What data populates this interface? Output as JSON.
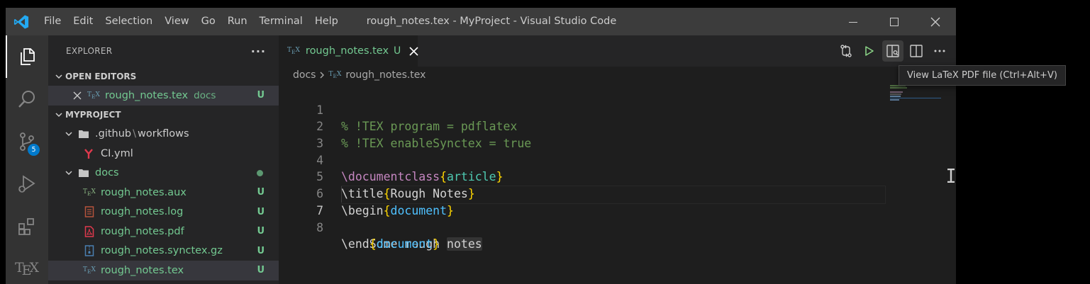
{
  "window": {
    "title": "rough_notes.tex - MyProject - Visual Studio Code",
    "menu": [
      "File",
      "Edit",
      "Selection",
      "View",
      "Go",
      "Run",
      "Terminal",
      "Help"
    ]
  },
  "activity_bar": {
    "items": [
      {
        "name": "explorer",
        "icon": "files-icon"
      },
      {
        "name": "search",
        "icon": "search-icon"
      },
      {
        "name": "source-control",
        "icon": "source-control-icon",
        "badge": "5"
      },
      {
        "name": "run-debug",
        "icon": "run-debug-icon"
      },
      {
        "name": "extensions",
        "icon": "extensions-icon"
      },
      {
        "name": "tex",
        "icon": "tex-icon",
        "label_main": "T",
        "label_sub": "E",
        "label_end": "X"
      }
    ]
  },
  "sidebar": {
    "title": "EXPLORER",
    "more": "···",
    "open_editors": {
      "label": "OPEN EDITORS",
      "items": [
        {
          "name": "rough_notes.tex",
          "desc": "docs",
          "status": "U"
        }
      ]
    },
    "project": {
      "label": "MYPROJECT",
      "github_folder": ".github",
      "github_sep": "\\",
      "github_sub": "workflows",
      "ci_file": "CI.yml",
      "docs_folder": "docs",
      "files": [
        {
          "name": "rough_notes.aux",
          "status": "U",
          "icon": "tex-file-icon"
        },
        {
          "name": "rough_notes.log",
          "status": "U",
          "icon": "log-file-icon"
        },
        {
          "name": "rough_notes.pdf",
          "status": "U",
          "icon": "pdf-file-icon"
        },
        {
          "name": "rough_notes.synctex.gz",
          "status": "U",
          "icon": "archive-file-icon"
        },
        {
          "name": "rough_notes.tex",
          "status": "U",
          "icon": "tex-file-icon"
        }
      ]
    }
  },
  "editor": {
    "tab": {
      "name": "rough_notes.tex",
      "status": "U"
    },
    "breadcrumb": {
      "folder": "docs",
      "file": "rough_notes.tex"
    },
    "line_numbers": [
      "1",
      "2",
      "3",
      "4",
      "5",
      "6",
      "7",
      "8"
    ],
    "code": {
      "l1": "% !TEX program = pdflatex",
      "l2": "% !TEX enableSynctex = true",
      "l4_cmd": "\\documentclass",
      "l4_arg": "article",
      "l5_cmd": "\\title",
      "l5_arg": "Rough Notes",
      "l6_cmd": "\\begin",
      "l6_arg": "document",
      "l7_a": "    Some rough ",
      "l7_b": "notes",
      "l8_cmd": "\\end",
      "l8_arg": "document",
      "brace_open": "{",
      "brace_close": "}"
    },
    "tooltip": "View LaTeX PDF file (Ctrl+Alt+V)"
  },
  "colors": {
    "accent": "#007acc",
    "untracked": "#73c991",
    "comment": "#6a9955",
    "keyword": "#c586c0",
    "brace": "#ffd700"
  }
}
